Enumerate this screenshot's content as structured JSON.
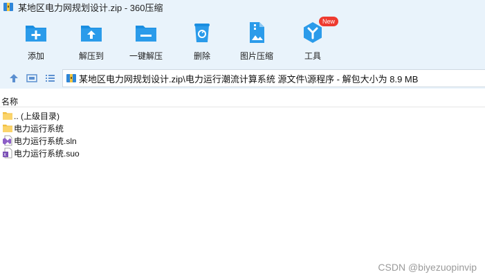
{
  "window": {
    "title": "某地区电力网规划设计.zip - 360压缩"
  },
  "toolbar": {
    "items": [
      {
        "label": "添加",
        "icon": "add-icon"
      },
      {
        "label": "解压到",
        "icon": "extract-to-icon"
      },
      {
        "label": "一键解压",
        "icon": "one-click-extract-icon"
      },
      {
        "label": "删除",
        "icon": "delete-icon"
      },
      {
        "label": "图片压缩",
        "icon": "image-compress-icon"
      },
      {
        "label": "工具",
        "icon": "tools-icon",
        "badge": "New"
      }
    ]
  },
  "addressbar": {
    "path": "某地区电力网规划设计.zip\\电力运行潮流计算系统 源文件\\源程序 - 解包大小为 8.9 MB"
  },
  "filelist": {
    "header": {
      "name": "名称"
    },
    "rows": [
      {
        "name": ".. (上级目录)",
        "icon": "parent-folder-icon"
      },
      {
        "name": "电力运行系统",
        "icon": "folder-icon"
      },
      {
        "name": "电力运行系统.sln",
        "icon": "sln-file-icon"
      },
      {
        "name": "电力运行系统.suo",
        "icon": "suo-file-icon"
      }
    ]
  },
  "watermark": "CSDN @biyezuopinvip",
  "colors": {
    "accent": "#1a8ee0",
    "chrome_bg": "#e9f3fb",
    "badge": "#ee3a2f",
    "folder": "#fbd46b"
  }
}
